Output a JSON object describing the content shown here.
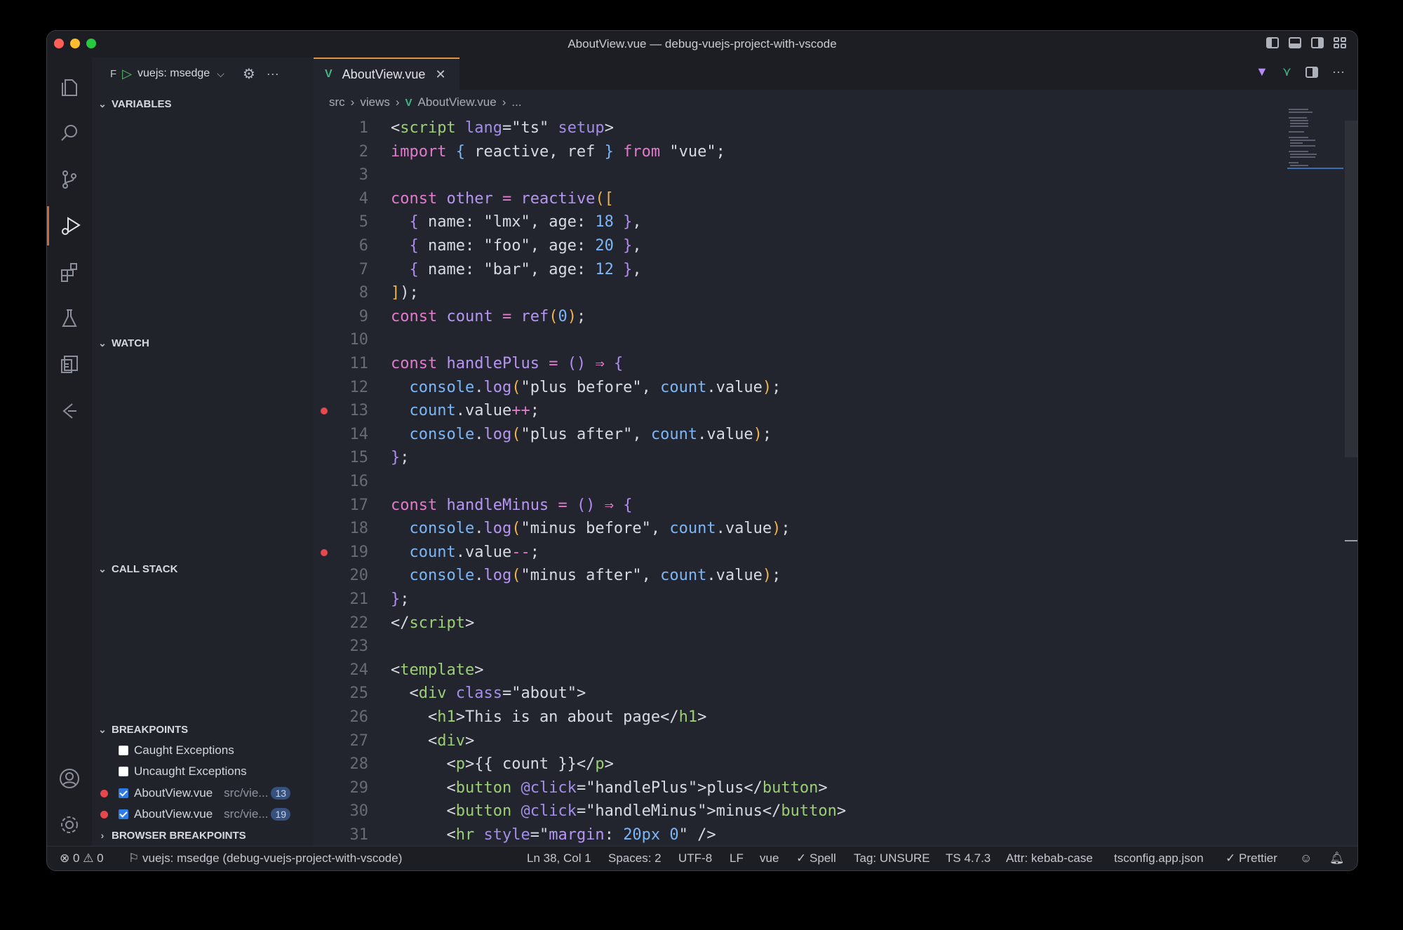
{
  "window": {
    "title": "AboutView.vue — debug-vuejs-project-with-vscode"
  },
  "debug": {
    "prefix": "F",
    "config": "vuejs: msedge"
  },
  "sidebar": {
    "variables": "VARIABLES",
    "watch": "WATCH",
    "call_stack": "CALL STACK",
    "breakpoints": "BREAKPOINTS",
    "browser_breakpoints": "BROWSER BREAKPOINTS",
    "bp_items": [
      {
        "label": "Caught Exceptions",
        "checked": false
      },
      {
        "label": "Uncaught Exceptions",
        "checked": false
      },
      {
        "label": "AboutView.vue",
        "path": "src/vie...",
        "line": "13",
        "checked": true
      },
      {
        "label": "AboutView.vue",
        "path": "src/vie...",
        "line": "19",
        "checked": true
      }
    ]
  },
  "editor": {
    "tab": "AboutView.vue",
    "breadcrumb": [
      "src",
      "views",
      "AboutView.vue",
      "..."
    ],
    "breakpoint_lines": [
      13,
      19
    ]
  },
  "status": {
    "errors": "0",
    "warnings": "0",
    "debug_session": "vuejs: msedge (debug-vuejs-project-with-vscode)",
    "position": "Ln 38, Col 1",
    "spaces": "Spaces: 2",
    "encoding": "UTF-8",
    "eol": "LF",
    "language": "vue",
    "spell": "Spell",
    "tag": "Tag: UNSURE",
    "ts": "TS 4.7.3",
    "attr": "Attr: kebab-case",
    "tsconfig": "tsconfig.app.json",
    "prettier": "Prettier"
  },
  "colors": {
    "accent_tab": "#e6923c",
    "breakpoint": "#e5484d",
    "keyword": "#e37acb",
    "function": "#b696f2"
  }
}
